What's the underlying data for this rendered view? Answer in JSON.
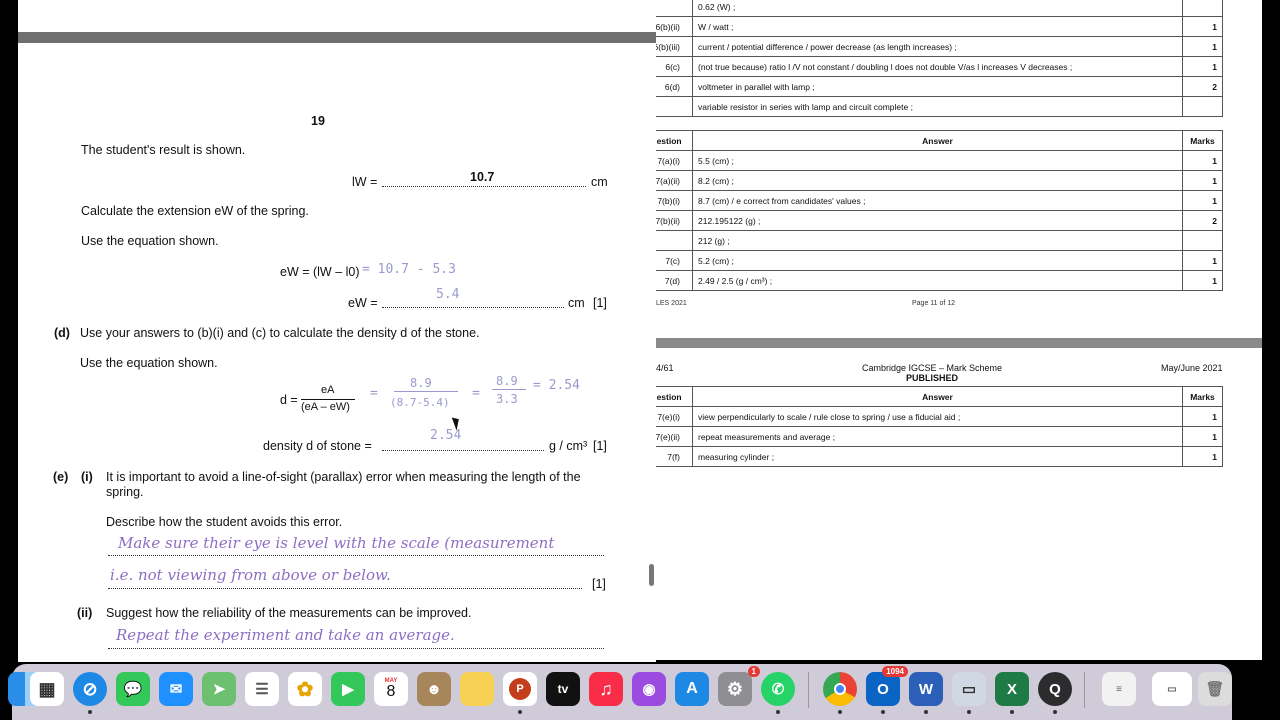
{
  "mark_scheme": {
    "top_table": [
      {
        "q": "",
        "a": "0.62 (W) ;",
        "m": ""
      },
      {
        "q": "6(b)(ii)",
        "a": "W / watt ;",
        "m": "1"
      },
      {
        "q": "6(b)(iii)",
        "a": "current / potential difference / power decrease (as length increases) ;",
        "m": "1"
      },
      {
        "q": "6(c)",
        "a": "(not true because) ratio l /V not constant / doubling l does not double V/as l increases V decreases ;",
        "m": "1"
      },
      {
        "q": "6(d)",
        "a": "voltmeter in parallel with lamp ;",
        "m": "2"
      },
      {
        "q": "",
        "a": "variable resistor in series with lamp and circuit complete ;",
        "m": ""
      }
    ],
    "headers": {
      "question": "uestion",
      "answer": "Answer",
      "marks": "Marks"
    },
    "mid_table": [
      {
        "q": "7(a)(i)",
        "a": "5.5 (cm) ;",
        "m": "1"
      },
      {
        "q": "7(a)(ii)",
        "a": "8.2 (cm) ;",
        "m": "1"
      },
      {
        "q": "7(b)(i)",
        "a": "8.7 (cm) / e correct from candidates' values ;",
        "m": "1"
      },
      {
        "q": "7(b)(ii)",
        "a": "212.195122 (g) ;",
        "m": "2"
      },
      {
        "q": "",
        "a": "212 (g) ;",
        "m": ""
      },
      {
        "q": "7(c)",
        "a": "5.2 (cm) ;",
        "m": "1"
      },
      {
        "q": "7(d)",
        "a": "2.49 / 2.5 (g / cm³) ;",
        "m": "1"
      }
    ],
    "footer_left": "LES 2021",
    "footer_center": "Page 11 of 12",
    "page_header": {
      "left": "4/61",
      "title": "Cambridge IGCSE – Mark Scheme",
      "subtitle": "PUBLISHED",
      "right": "May/June 2021"
    },
    "bottom_table": [
      {
        "q": "7(e)(i)",
        "a": "view perpendicularly to scale / rule close to spring / use a fiducial aid ;",
        "m": "1"
      },
      {
        "q": "7(e)(ii)",
        "a": "repeat measurements and average ;",
        "m": "1"
      },
      {
        "q": "7(f)",
        "a": "measuring cylinder ;",
        "m": "1"
      }
    ]
  },
  "question_paper": {
    "page_number": "19",
    "line1": "The student's result is shown.",
    "lw_label": "lW =",
    "lw_value": "10.7",
    "lw_unit": "cm",
    "calc_ext": "Calculate the extension eW of the spring.",
    "use_eq1": "Use the equation shown.",
    "eq_ew": "eW = (lW – l0)",
    "hw_ew_calc": "= 10.7 - 5.3",
    "hw_ew_ans": "5.4",
    "ew_label": "eW =",
    "ew_unit": "cm",
    "ew_mark": "[1]",
    "d_label": "(d)",
    "d_text": "Use your answers to (b)(i) and (c) to calculate the density d of the stone.",
    "use_eq2": "Use the equation shown.",
    "eq_d_lhs": "d =",
    "eq_d_num": "eA",
    "eq_d_den": "(eA – eW)",
    "hw_d_num": "8.9",
    "hw_d_den": "(8.7-5.4)",
    "hw_d_eq": "=",
    "hw_d_frac_num": "8.9",
    "hw_d_frac_den": "3.3",
    "hw_d_result": "= 2.54",
    "density_label": "density d of stone =",
    "density_hw": "2.54",
    "density_unit": "g / cm³",
    "density_mark": "[1]",
    "e_label": "(e)",
    "ei_label": "(i)",
    "ei_text_1": "It is important to avoid a line-of-sight (parallax) error when measuring the length of the",
    "ei_text_2": "spring.",
    "ei_describe": "Describe how the student avoids this error.",
    "ei_hw_1": "Make sure their eye is level with the scale (measurement",
    "ei_hw_2": "i.e. not viewing from above or below.",
    "ei_mark": "[1]",
    "eii_label": "(ii)",
    "eii_text": "Suggest how the reliability of the measurements can be improved.",
    "eii_hw": "Repeat the experiment and take an average."
  },
  "dock": {
    "calendar_month": "MAY",
    "calendar_day": "8",
    "settings_badge": "1",
    "outlook_badge": "1094",
    "tv_label": "tv",
    "icons": [
      "finder-icon",
      "launchpad-icon",
      "safari-icon",
      "messages-icon",
      "mail-icon",
      "maps-icon",
      "reminders-icon",
      "photos-icon",
      "facetime-icon",
      "calendar-icon",
      "contacts-icon",
      "notes-icon",
      "powerpoint-icon",
      "apple-tv-icon",
      "music-icon",
      "podcasts-icon",
      "app-store-icon",
      "system-settings-icon",
      "whatsapp-icon",
      "chrome-icon",
      "outlook-icon",
      "word-icon",
      "preview-icon",
      "excel-icon",
      "quicktime-icon",
      "document-icon",
      "screenshot-icon",
      "trash-icon"
    ]
  }
}
